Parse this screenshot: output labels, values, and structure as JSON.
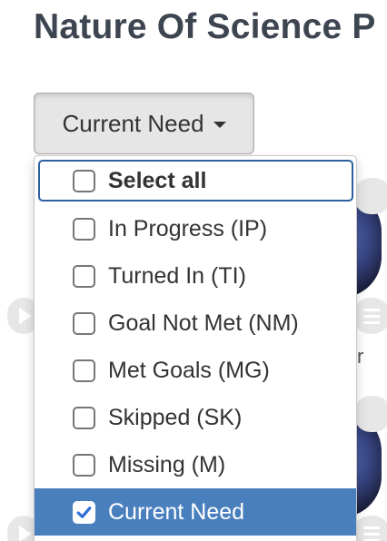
{
  "page": {
    "title": "Nature Of Science P"
  },
  "background": {
    "partial_text": "r"
  },
  "dropdown": {
    "label": "Current Need",
    "options": [
      {
        "label": "Select all",
        "checked": false
      },
      {
        "label": "In Progress (IP)",
        "checked": false
      },
      {
        "label": "Turned In (TI)",
        "checked": false
      },
      {
        "label": "Goal Not Met (NM)",
        "checked": false
      },
      {
        "label": "Met Goals (MG)",
        "checked": false
      },
      {
        "label": "Skipped (SK)",
        "checked": false
      },
      {
        "label": "Missing (M)",
        "checked": false
      },
      {
        "label": "Current Need",
        "checked": true
      }
    ]
  },
  "colors": {
    "active_bg": "#4a7fbe",
    "focus_border": "#2e5f9e",
    "title": "#3d4650"
  }
}
